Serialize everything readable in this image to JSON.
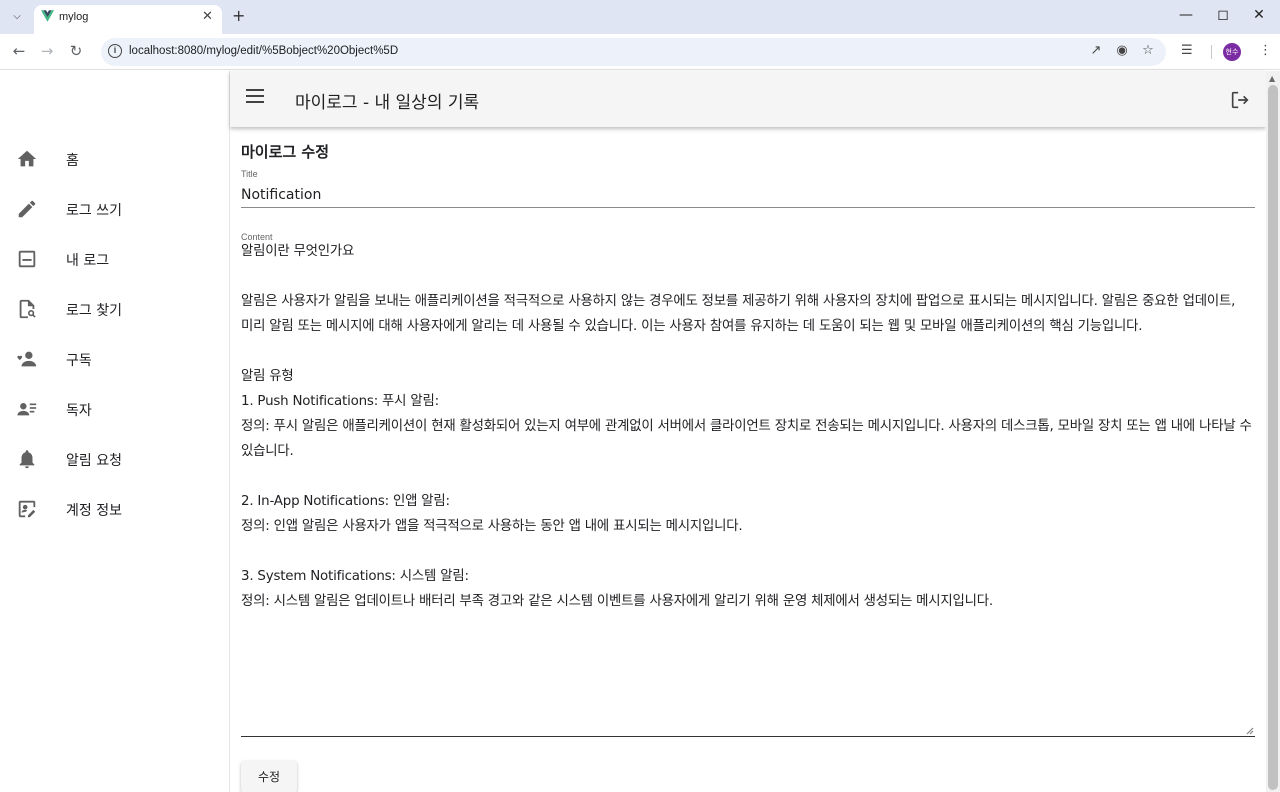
{
  "browser": {
    "tab_title": "mylog",
    "url": "localhost:8080/mylog/edit/%5Bobject%20Object%5D",
    "profile_initials": "현수"
  },
  "app": {
    "title": "마이로그 - 내 일상의 기록"
  },
  "sidebar": {
    "items": [
      {
        "label": "홈",
        "icon": "home-icon"
      },
      {
        "label": "로그 쓰기",
        "icon": "pencil-icon"
      },
      {
        "label": "내 로그",
        "icon": "note-icon"
      },
      {
        "label": "로그 찾기",
        "icon": "search-document-icon"
      },
      {
        "label": "구독",
        "icon": "subscribe-icon"
      },
      {
        "label": "독자",
        "icon": "readers-icon"
      },
      {
        "label": "알림 요청",
        "icon": "bell-icon"
      },
      {
        "label": "계정 정보",
        "icon": "account-edit-icon"
      }
    ]
  },
  "form": {
    "heading": "마이로그 수정",
    "title_label": "Title",
    "title_value": "Notification",
    "content_label": "Content",
    "content_value": "알림이란 무엇인가요\n\n알림은 사용자가 알림을 보내는 애플리케이션을 적극적으로 사용하지 않는 경우에도 정보를 제공하기 위해 사용자의 장치에 팝업으로 표시되는 메시지입니다. 알림은 중요한 업데이트, 미리 알림 또는 메시지에 대해 사용자에게 알리는 데 사용될 수 있습니다. 이는 사용자 참여를 유지하는 데 도움이 되는 웹 및 모바일 애플리케이션의 핵심 기능입니다.\n\n알림 유형\n1. Push Notifications: 푸시 알림:\n정의: 푸시 알림은 애플리케이션이 현재 활성화되어 있는지 여부에 관계없이 서버에서 클라이언트 장치로 전송되는 메시지입니다. 사용자의 데스크톱, 모바일 장치 또는 앱 내에 나타날 수 있습니다.\n\n2. In-App Notifications: 인앱 알림:\n정의: 인앱 알림은 사용자가 앱을 적극적으로 사용하는 동안 앱 내에 표시되는 메시지입니다.\n\n3. System Notifications: 시스템 알림:\n정의: 시스템 알림은 업데이트나 배터리 부족 경고와 같은 시스템 이벤트를 사용자에게 알리기 위해 운영 체제에서 생성되는 메시지입니다.",
    "submit_label": "수정"
  },
  "colors": {
    "appbar_bg": "#f5f5f5",
    "profile_bg": "#7b2ca3",
    "vue_green": "#41b883",
    "vue_dark": "#35495e"
  }
}
